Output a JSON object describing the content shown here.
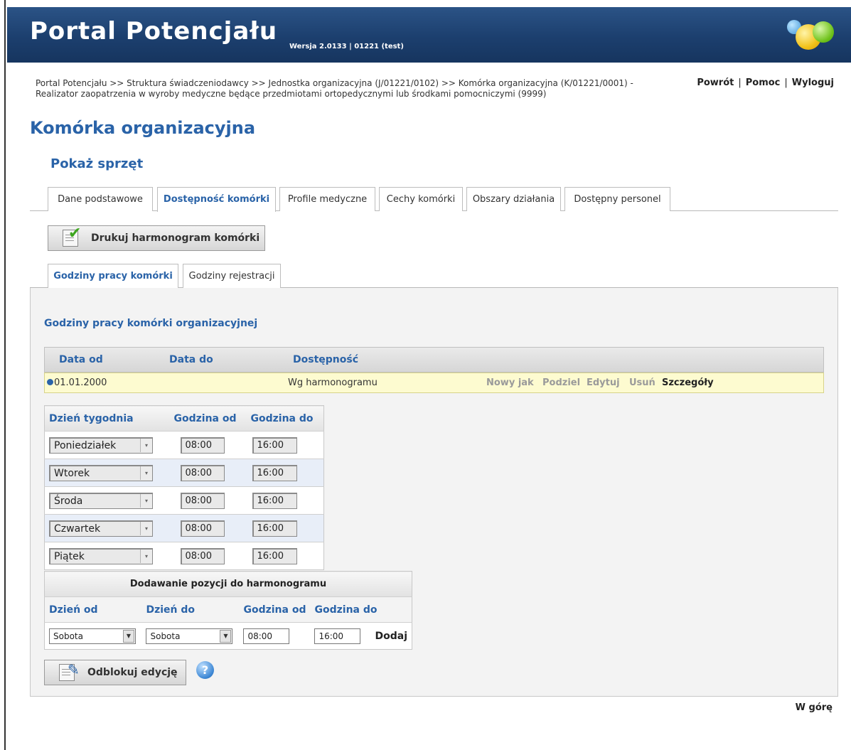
{
  "header": {
    "title": "Portal Potencjału",
    "version": "Wersja 2.0133 | 01221 (test)"
  },
  "breadcrumb": "Portal Potencjału >> Struktura świadczeniodawcy >> Jednostka organizacyjna (J/01221/0102) >> Komórka organizacyjna (K/01221/0001) - Realizator zaopatrzenia w wyroby medyczne będące przedmiotami ortopedycznymi lub środkami pomocniczymi (9999)",
  "toplinks": {
    "back": "Powrót",
    "help": "Pomoc",
    "logout": "Wyloguj",
    "sep": "|"
  },
  "page_title": "Komórka organizacyjna",
  "subtitle": "Pokaż sprzęt",
  "tabs": [
    {
      "label": "Dane podstawowe"
    },
    {
      "label": "Dostępność komórki",
      "active": true
    },
    {
      "label": "Profile medyczne"
    },
    {
      "label": "Cechy komórki"
    },
    {
      "label": "Obszary działania"
    },
    {
      "label": "Dostępny personel"
    }
  ],
  "print_button": "Drukuj harmonogram komórki",
  "subtabs": [
    {
      "label": "Godziny pracy komórki",
      "active": true
    },
    {
      "label": "Godziny rejestracji"
    }
  ],
  "section_title": "Godziny pracy komórki organizacyjnej",
  "list": {
    "headers": {
      "date_from": "Data od",
      "date_to": "Data do",
      "availability": "Dostępność"
    },
    "row": {
      "date_from": "01.01.2000",
      "date_to": "",
      "availability": "Wg harmonogramu",
      "actions": {
        "new_like": "Nowy jak",
        "split": "Podziel",
        "edit": "Edytuj",
        "delete": "Usuń",
        "details": "Szczegóły"
      }
    }
  },
  "schedule": {
    "headers": {
      "day": "Dzień tygodnia",
      "from": "Godzina od",
      "to": "Godzina do"
    },
    "rows": [
      {
        "day": "Poniedziałek",
        "from": "08:00",
        "to": "16:00"
      },
      {
        "day": "Wtorek",
        "from": "08:00",
        "to": "16:00"
      },
      {
        "day": "Środa",
        "from": "08:00",
        "to": "16:00"
      },
      {
        "day": "Czwartek",
        "from": "08:00",
        "to": "16:00"
      },
      {
        "day": "Piątek",
        "from": "08:00",
        "to": "16:00"
      }
    ]
  },
  "add_entry": {
    "caption": "Dodawanie pozycji do harmonogramu",
    "labels": {
      "day_from": "Dzień od",
      "day_to": "Dzień do",
      "hour_from": "Godzina od",
      "hour_to": "Godzina do"
    },
    "values": {
      "day_from": "Sobota",
      "day_to": "Sobota",
      "hour_from": "08:00",
      "hour_to": "16:00"
    },
    "add_label": "Dodaj"
  },
  "unlock_button": "Odblokuj edycję",
  "help_icon": "?",
  "top_link": "W górę",
  "colors": {
    "header_bg": "#1c3f6e",
    "accent": "#2a63a8",
    "highlight_row": "#fdfbd0",
    "alt_row": "#e8eef8"
  }
}
